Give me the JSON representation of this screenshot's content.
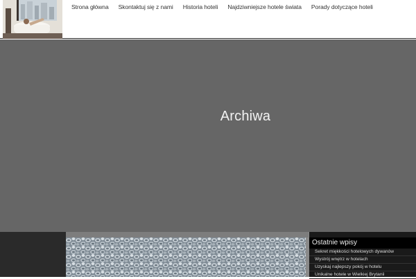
{
  "header": {
    "logo_icon": "hotel-bathtub-photo",
    "nav": [
      {
        "label": "Strona główna"
      },
      {
        "label": "Skontaktuj się z nami"
      },
      {
        "label": "Historia hoteli"
      },
      {
        "label": "Najdziwniejsze hotele świata"
      },
      {
        "label": "Porady dotyczące hoteli"
      }
    ]
  },
  "hero": {
    "title": "Archiwa"
  },
  "featured": {
    "image_icon": "carpet-texture-photo"
  },
  "sidebar": {
    "widget_title": "Ostatnie wpisy",
    "items": [
      {
        "label": "Sekret miękkości hotelowych dywanów"
      },
      {
        "label": "Wystrój wnętrz w hotelach"
      },
      {
        "label": "Uzyskaj najlepszy pokój w hotelu"
      },
      {
        "label": "Unikalne hotele w Wielkiej Brytanii"
      }
    ]
  },
  "colors": {
    "hero_bg": "#666666",
    "sidebar_bg": "#1a1a1a",
    "widget_title_bg": "#000000"
  }
}
